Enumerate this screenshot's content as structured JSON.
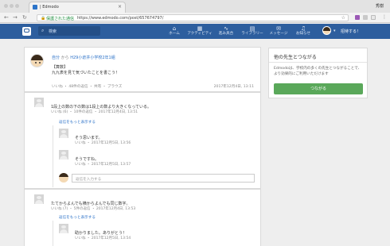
{
  "browser": {
    "tab_title": "| Edmodo",
    "tab_close": "×",
    "profile_name": "秀樹",
    "secure_label": "保護された通信",
    "url": "https://www.edmodo.com/post/657674797/"
  },
  "nav": {
    "search_placeholder": "検索",
    "items": [
      {
        "label": "ホーム",
        "icon": "home-icon"
      },
      {
        "label": "アクティビティ",
        "icon": "activity-icon"
      },
      {
        "label": "進み具合",
        "icon": "progress-icon"
      },
      {
        "label": "ライブラリー",
        "icon": "library-icon"
      },
      {
        "label": "メッセージ",
        "icon": "message-icon"
      },
      {
        "label": "お知らせ",
        "icon": "bell-icon"
      }
    ],
    "invite": "招待する！"
  },
  "post": {
    "author": "自分",
    "from_word": "から",
    "group": "H29小倉井小学校2年1組",
    "line1": "【算数】",
    "line2": "九九表を見て気づいたことを書こう！",
    "like": "いいね",
    "replies": "48件の返信",
    "share": "共有",
    "browse": "ブラウズ",
    "date": "2017年12月4日, 13:11"
  },
  "comments": [
    {
      "text": "1段上の数の下の数は1段上の数より大きくなっている。",
      "meta": "いいね (6)  ・  10件の返信  ・  2017年12月4日, 13:51",
      "more": "返信をもっと表示する",
      "replies": [
        {
          "text": "そう思います。",
          "meta": "いいね  ・  2017年12月5日, 13:56"
        },
        {
          "text": "そうですね。",
          "meta": "いいね  ・  2017年12月5日, 13:57"
        }
      ],
      "reply_placeholder": "返信を入力する"
    },
    {
      "text": "たてからよんでも横からよんでも同じ数字。",
      "meta": "いいね (7)  ・  5件の返信  ・  2017年12月4日, 13:53",
      "more": "返信をもっと表示する",
      "replies": [
        {
          "text": "助かりました。ありがとう！",
          "meta": "いいね  ・  2017年12月5日, 13:54"
        }
      ]
    }
  ],
  "side": {
    "title": "他の先生とつながる",
    "desc": "Edmodoは、学校内の多くの先生とつながることで、より効果的にご利用いただけます",
    "button": "つながる"
  },
  "colors": {
    "nav": "#2d5e9e",
    "accent_link": "#2c72c8",
    "connect_button": "#5aa85a"
  }
}
